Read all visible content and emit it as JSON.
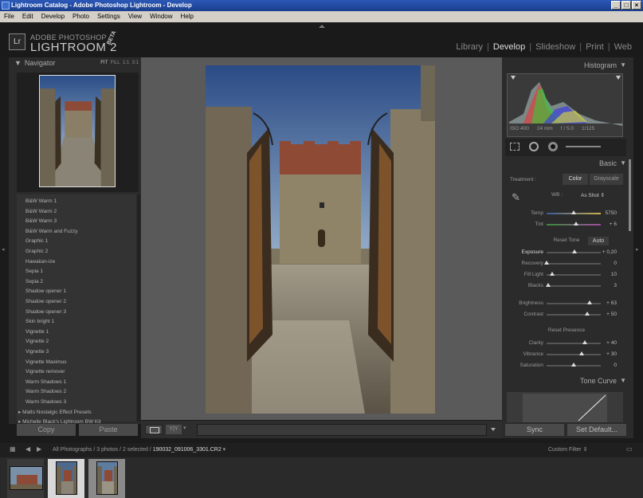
{
  "window": {
    "title": "Lightroom Catalog - Adobe Photoshop Lightroom - Develop",
    "controls": [
      "_",
      "□",
      "×"
    ]
  },
  "menubar": [
    "File",
    "Edit",
    "Develop",
    "Photo",
    "Settings",
    "View",
    "Window",
    "Help"
  ],
  "brand": {
    "line1": "ADOBE PHOTOSHOP",
    "line2": "LIGHTROOM 2",
    "badge": "BETA",
    "logo": "Lr"
  },
  "modules": {
    "items": [
      "Library",
      "Develop",
      "Slideshow",
      "Print",
      "Web"
    ],
    "active": "Develop"
  },
  "navigator": {
    "title": "Navigator",
    "options": [
      "FIT",
      "FILL",
      "1:1",
      "3:1"
    ]
  },
  "presets": {
    "items": [
      "B&W Warm 1",
      "B&W Warm 2",
      "B&W Warm 3",
      "B&W Warm and Fuzzy",
      "Graphic 1",
      "Graphic 2",
      "Hawaiian-ize",
      "Sepia 1",
      "Sepia 2",
      "Shadow opener 1",
      "Shadow opener 2",
      "Shadow opener 3",
      "Skin bright 1",
      "Vignette 1",
      "Vignette 2",
      "Vignette 3",
      "Vignette Maximus",
      "Vignette remover",
      "Warm Shadows 1",
      "Warm Shadows 2",
      "Warm Shadows 3"
    ],
    "folders": [
      "Matts Nostalgic Effect Presets",
      "Michelle Black's Lightroom BW Kit"
    ]
  },
  "left_buttons": {
    "copy": "Copy",
    "paste": "Paste"
  },
  "histogram": {
    "title": "Histogram",
    "iso": "ISO 400",
    "focal": "24 mm",
    "aperture": "f / 5.0",
    "shutter": "1/125"
  },
  "basic": {
    "title": "Basic",
    "treatment_label": "Treatment :",
    "treatment_color": "Color",
    "treatment_gray": "Grayscale",
    "wb_label": "WB :",
    "wb_value": "As Shot",
    "reset_tone": "Reset Tone",
    "auto": "Auto",
    "reset_presence": "Reset Presence",
    "sliders": {
      "temp": {
        "label": "Temp",
        "value": "5750",
        "level": 0.5
      },
      "tint": {
        "label": "Tint",
        "value": "+ 6",
        "level": 0.55
      },
      "exposure": {
        "label": "Exposure",
        "value": "+ 0,20",
        "level": 0.52
      },
      "recovery": {
        "label": "Recovery",
        "value": "0",
        "level": 0.0
      },
      "filllight": {
        "label": "Fill Light",
        "value": "10",
        "level": 0.1
      },
      "blacks": {
        "label": "Blacks",
        "value": "3",
        "level": 0.03
      },
      "brightness": {
        "label": "Brightness",
        "value": "+ 63",
        "level": 0.8
      },
      "contrast": {
        "label": "Contrast",
        "value": "+ 50",
        "level": 0.75
      },
      "clarity": {
        "label": "Clarity",
        "value": "+ 40",
        "level": 0.7
      },
      "vibrance": {
        "label": "Vibrance",
        "value": "+ 30",
        "level": 0.65
      },
      "saturation": {
        "label": "Saturation",
        "value": "0",
        "level": 0.5
      }
    }
  },
  "tonecurve": {
    "title": "Tone Curve"
  },
  "right_buttons": {
    "sync": "Sync",
    "setdefault": "Set Default..."
  },
  "filmstrip": {
    "source": "All Photographs / 3 photos / 2 selected /",
    "filename": "190032_091006_3301.CR2",
    "filter": "Custom Filter"
  },
  "colors": {
    "bg": "#1b1b1b",
    "panel": "#2b2b2b",
    "center": "#5a5a5a"
  }
}
